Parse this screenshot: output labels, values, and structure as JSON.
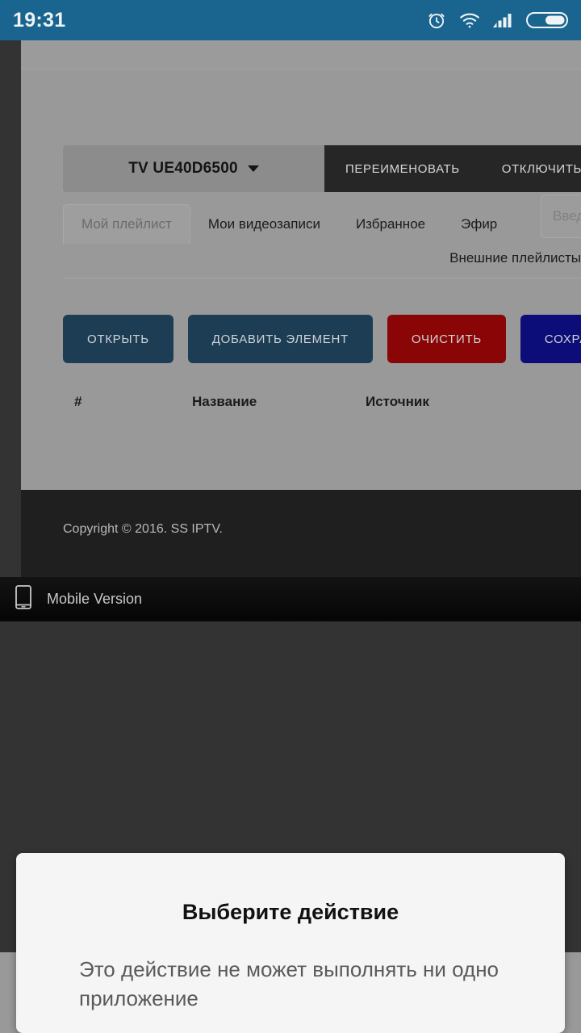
{
  "statusbar": {
    "time": "19:31",
    "icons": [
      "alarm-clock-icon",
      "wifi-icon",
      "signal-bars-icon",
      "battery-icon"
    ],
    "background_color": "#1a6490"
  },
  "page": {
    "device": {
      "name": "TV UE40D6500",
      "rename_label": "ПЕРЕИМЕНОВАТЬ",
      "disconnect_label": "ОТКЛЮЧИТЬ"
    },
    "tabs": [
      {
        "label": "Мой плейлист",
        "active": true
      },
      {
        "label": "Мои видеозаписи",
        "active": false
      },
      {
        "label": "Избранное",
        "active": false
      },
      {
        "label": "Эфир",
        "active": false
      }
    ],
    "external_input_placeholder": "Введите",
    "external_label": "Внешние плейлисты",
    "actions": [
      {
        "label": "ОТКРЫТЬ",
        "color": "#1d3d55"
      },
      {
        "label": "ДОБАВИТЬ ЭЛЕМЕНТ",
        "color": "#1d3d55"
      },
      {
        "label": "ОЧИСТИТЬ",
        "color": "#8a0505"
      },
      {
        "label": "СОХРАНИТЬ",
        "color": "#0d0d7a"
      }
    ],
    "table_headers": [
      "#",
      "Название",
      "Источник"
    ],
    "footer": {
      "copyright": "Copyright © 2016. SS IPTV."
    }
  },
  "mobile_bar": {
    "label": "Mobile Version",
    "icon": "phone-icon"
  },
  "dialog": {
    "title": "Выберите действие",
    "message": "Это действие не может выполнять ни одно приложение"
  }
}
